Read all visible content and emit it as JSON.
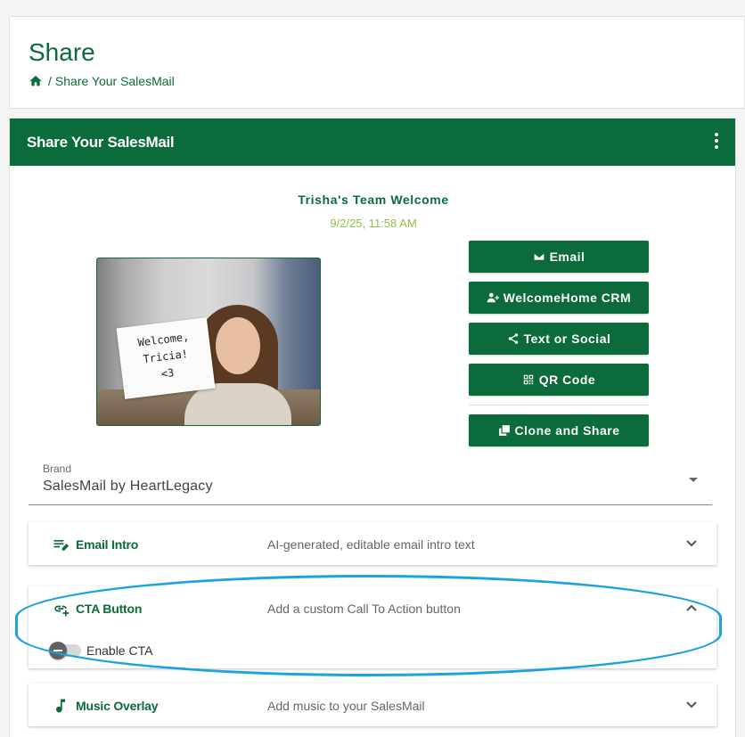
{
  "header": {
    "title": "Share",
    "breadcrumb": {
      "separator": "/",
      "current": "Share Your SalesMail"
    }
  },
  "card": {
    "title": "Share Your SalesMail"
  },
  "video": {
    "title": "Trisha's Team Welcome",
    "date": "9/2/25, 11:58 AM",
    "sign_text": [
      "Welcome,",
      "Tricia!",
      "<3"
    ]
  },
  "share_buttons": {
    "email": "Email",
    "crm": "WelcomeHome CRM",
    "text_social": "Text or Social",
    "qr_code": "QR Code",
    "clone_share": "Clone and Share"
  },
  "brand": {
    "label": "Brand",
    "value": "SalesMail by HeartLegacy"
  },
  "panels": {
    "email_intro": {
      "title": "Email Intro",
      "description": "AI-generated, editable email intro text",
      "expanded": false
    },
    "cta_button": {
      "title": "CTA Button",
      "description": "Add a custom Call To Action button",
      "expanded": true,
      "toggle_label": "Enable CTA",
      "toggle_on": false
    },
    "music_overlay": {
      "title": "Music Overlay",
      "description": "Add music to your SalesMail",
      "expanded": false
    }
  },
  "colors": {
    "brand_green": "#0b6b3a",
    "date_green": "#8bc34a",
    "highlight_blue": "#1aa3e0"
  }
}
